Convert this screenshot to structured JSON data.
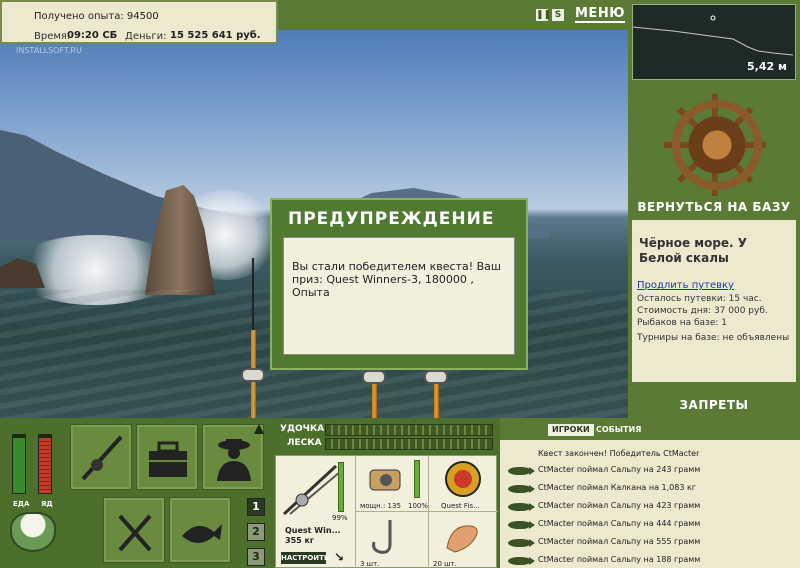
{
  "status": {
    "exp_label": "Получено опыта:",
    "exp_value": "94500",
    "time_label": "Время:",
    "time_value": "09:20 СБ",
    "money_label": "Деньги:",
    "money_value": "15 525 641 руб."
  },
  "watermark": "INSTALLSOFT.RU",
  "topbar": {
    "pause_icon": "pause-icon",
    "sound_label": "S",
    "menu_label": "МЕНЮ"
  },
  "depth": {
    "value": "5,42 м"
  },
  "base": {
    "return_label": "ВЕРНУТЬСЯ НА БАЗУ",
    "title": "Чёрное море. У Белой скалы",
    "extend_link": "Продлить путевку",
    "lines": [
      "Осталось путевки: 15 час.",
      "Стоимость дня: 37 000 руб.",
      "Рыбаков на базе: 1",
      "Турниры на базе: не объявлены"
    ],
    "bans_label": "ЗАПРЕТЫ"
  },
  "dialog": {
    "title": "ПРЕДУПРЕЖДЕНИЕ",
    "message": "Вы стали победителем квеста! Ваш приз: Quest Winners-3, 180000 , Опыта"
  },
  "needs": {
    "food_label": "ЕДА",
    "poison_label": "ЯД",
    "food_level": 0.95,
    "poison_level": 0.95
  },
  "pager": [
    "1",
    "2",
    "3"
  ],
  "tackle": {
    "rod_label": "УДОЧКА",
    "line_label": "ЛЕСКА",
    "rod_name": "Quest Win...",
    "rod_weight": "355 кг",
    "setup_label": "НАСТРОИТЬ",
    "rod_condition": "99%",
    "reel_label": "мощн.: 135",
    "reel_condition": "100%",
    "line_name": "Quest Fis...",
    "hook_count": "3 шт.",
    "bait_count": "20 шт."
  },
  "events": {
    "tab_players": "ИГРОКИ",
    "tab_events": "СОБЫТИЯ",
    "rows": [
      "Квест закончен! Победитель CtMacter",
      "CtMacter поймал Сальпу на 243 грамм",
      "CtMacter поймал Калкана на 1,083 кг",
      "CtMacter поймал Сальпу на 423 грамм",
      "CtMacter поймал Сальпу на 444 грамм",
      "CtMacter поймал Сальпу на 555 грамм",
      "CtMacter поймал Сальпу на 188 грамм"
    ]
  },
  "colors": {
    "panel_green": "#5a7a36",
    "panel_cream": "#ece9cf",
    "food_red": "#c83a2a",
    "food_green": "#3a8a2a"
  }
}
